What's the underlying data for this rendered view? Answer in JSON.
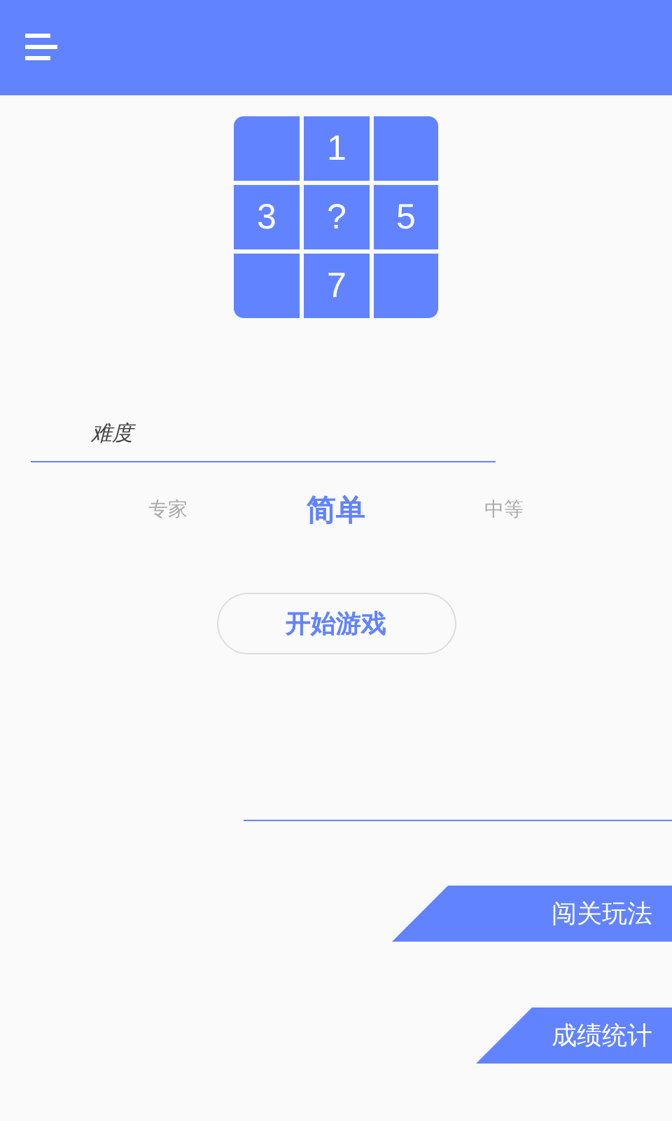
{
  "puzzle": {
    "cells": [
      {
        "kind": "blank"
      },
      {
        "kind": "number",
        "label": "1"
      },
      {
        "kind": "blank"
      },
      {
        "kind": "number",
        "label": "3"
      },
      {
        "kind": "number",
        "label": "?"
      },
      {
        "kind": "number",
        "label": "5"
      },
      {
        "kind": "blank"
      },
      {
        "kind": "number",
        "label": "7"
      },
      {
        "kind": "blank"
      }
    ]
  },
  "difficulty": {
    "label": "难度",
    "options": [
      {
        "label": "专家",
        "selected": false
      },
      {
        "label": "简单",
        "selected": true
      },
      {
        "label": "中等",
        "selected": false
      }
    ]
  },
  "start_button": "开始游戏",
  "menu_buttons": [
    {
      "label": "闯关玩法"
    },
    {
      "label": "成绩统计"
    }
  ]
}
